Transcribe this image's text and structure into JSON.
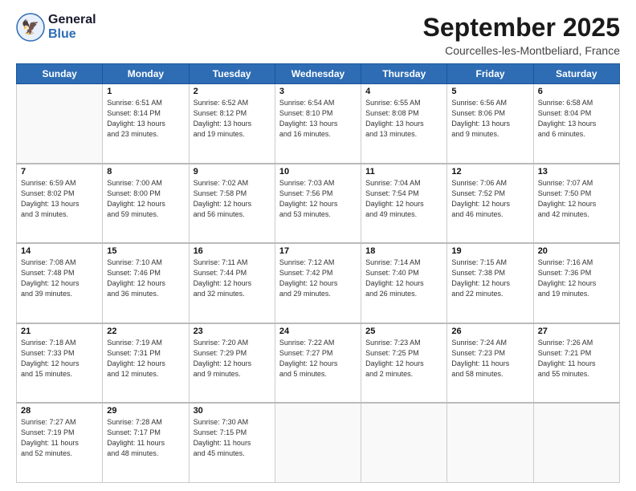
{
  "logo": {
    "line1": "General",
    "line2": "Blue"
  },
  "header": {
    "title": "September 2025",
    "subtitle": "Courcelles-les-Montbeliard, France"
  },
  "weekdays": [
    "Sunday",
    "Monday",
    "Tuesday",
    "Wednesday",
    "Thursday",
    "Friday",
    "Saturday"
  ],
  "weeks": [
    [
      {
        "day": "",
        "info": ""
      },
      {
        "day": "1",
        "info": "Sunrise: 6:51 AM\nSunset: 8:14 PM\nDaylight: 13 hours\nand 23 minutes."
      },
      {
        "day": "2",
        "info": "Sunrise: 6:52 AM\nSunset: 8:12 PM\nDaylight: 13 hours\nand 19 minutes."
      },
      {
        "day": "3",
        "info": "Sunrise: 6:54 AM\nSunset: 8:10 PM\nDaylight: 13 hours\nand 16 minutes."
      },
      {
        "day": "4",
        "info": "Sunrise: 6:55 AM\nSunset: 8:08 PM\nDaylight: 13 hours\nand 13 minutes."
      },
      {
        "day": "5",
        "info": "Sunrise: 6:56 AM\nSunset: 8:06 PM\nDaylight: 13 hours\nand 9 minutes."
      },
      {
        "day": "6",
        "info": "Sunrise: 6:58 AM\nSunset: 8:04 PM\nDaylight: 13 hours\nand 6 minutes."
      }
    ],
    [
      {
        "day": "7",
        "info": "Sunrise: 6:59 AM\nSunset: 8:02 PM\nDaylight: 13 hours\nand 3 minutes."
      },
      {
        "day": "8",
        "info": "Sunrise: 7:00 AM\nSunset: 8:00 PM\nDaylight: 12 hours\nand 59 minutes."
      },
      {
        "day": "9",
        "info": "Sunrise: 7:02 AM\nSunset: 7:58 PM\nDaylight: 12 hours\nand 56 minutes."
      },
      {
        "day": "10",
        "info": "Sunrise: 7:03 AM\nSunset: 7:56 PM\nDaylight: 12 hours\nand 53 minutes."
      },
      {
        "day": "11",
        "info": "Sunrise: 7:04 AM\nSunset: 7:54 PM\nDaylight: 12 hours\nand 49 minutes."
      },
      {
        "day": "12",
        "info": "Sunrise: 7:06 AM\nSunset: 7:52 PM\nDaylight: 12 hours\nand 46 minutes."
      },
      {
        "day": "13",
        "info": "Sunrise: 7:07 AM\nSunset: 7:50 PM\nDaylight: 12 hours\nand 42 minutes."
      }
    ],
    [
      {
        "day": "14",
        "info": "Sunrise: 7:08 AM\nSunset: 7:48 PM\nDaylight: 12 hours\nand 39 minutes."
      },
      {
        "day": "15",
        "info": "Sunrise: 7:10 AM\nSunset: 7:46 PM\nDaylight: 12 hours\nand 36 minutes."
      },
      {
        "day": "16",
        "info": "Sunrise: 7:11 AM\nSunset: 7:44 PM\nDaylight: 12 hours\nand 32 minutes."
      },
      {
        "day": "17",
        "info": "Sunrise: 7:12 AM\nSunset: 7:42 PM\nDaylight: 12 hours\nand 29 minutes."
      },
      {
        "day": "18",
        "info": "Sunrise: 7:14 AM\nSunset: 7:40 PM\nDaylight: 12 hours\nand 26 minutes."
      },
      {
        "day": "19",
        "info": "Sunrise: 7:15 AM\nSunset: 7:38 PM\nDaylight: 12 hours\nand 22 minutes."
      },
      {
        "day": "20",
        "info": "Sunrise: 7:16 AM\nSunset: 7:36 PM\nDaylight: 12 hours\nand 19 minutes."
      }
    ],
    [
      {
        "day": "21",
        "info": "Sunrise: 7:18 AM\nSunset: 7:33 PM\nDaylight: 12 hours\nand 15 minutes."
      },
      {
        "day": "22",
        "info": "Sunrise: 7:19 AM\nSunset: 7:31 PM\nDaylight: 12 hours\nand 12 minutes."
      },
      {
        "day": "23",
        "info": "Sunrise: 7:20 AM\nSunset: 7:29 PM\nDaylight: 12 hours\nand 9 minutes."
      },
      {
        "day": "24",
        "info": "Sunrise: 7:22 AM\nSunset: 7:27 PM\nDaylight: 12 hours\nand 5 minutes."
      },
      {
        "day": "25",
        "info": "Sunrise: 7:23 AM\nSunset: 7:25 PM\nDaylight: 12 hours\nand 2 minutes."
      },
      {
        "day": "26",
        "info": "Sunrise: 7:24 AM\nSunset: 7:23 PM\nDaylight: 11 hours\nand 58 minutes."
      },
      {
        "day": "27",
        "info": "Sunrise: 7:26 AM\nSunset: 7:21 PM\nDaylight: 11 hours\nand 55 minutes."
      }
    ],
    [
      {
        "day": "28",
        "info": "Sunrise: 7:27 AM\nSunset: 7:19 PM\nDaylight: 11 hours\nand 52 minutes."
      },
      {
        "day": "29",
        "info": "Sunrise: 7:28 AM\nSunset: 7:17 PM\nDaylight: 11 hours\nand 48 minutes."
      },
      {
        "day": "30",
        "info": "Sunrise: 7:30 AM\nSunset: 7:15 PM\nDaylight: 11 hours\nand 45 minutes."
      },
      {
        "day": "",
        "info": ""
      },
      {
        "day": "",
        "info": ""
      },
      {
        "day": "",
        "info": ""
      },
      {
        "day": "",
        "info": ""
      }
    ]
  ]
}
